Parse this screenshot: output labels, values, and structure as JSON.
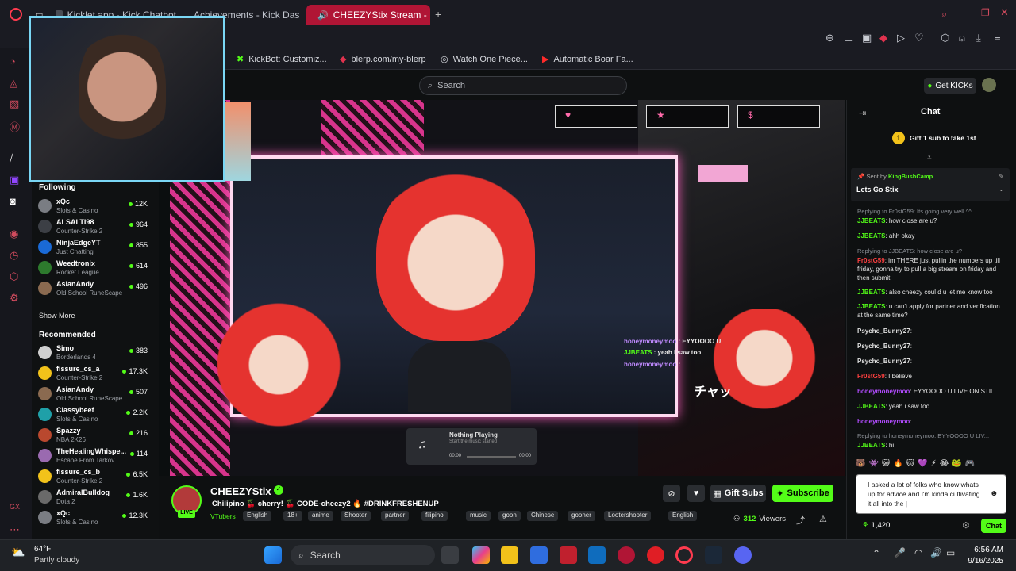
{
  "browser": {
    "tabs": [
      {
        "label": "Kicklet.app - Kick Chatbot"
      },
      {
        "label": "Achievements - Kick Das"
      },
      {
        "label": "CHEEZYStix Stream -"
      }
    ],
    "new_tab": "+",
    "bookmarks": [
      {
        "label": "KickBot: Customiz..."
      },
      {
        "label": "blerp.com/my-blerp"
      },
      {
        "label": "Watch One Piece..."
      },
      {
        "label": "Automatic Boar Fa..."
      }
    ]
  },
  "header": {
    "search_placeholder": "Search",
    "get_kicks": "Get KICKs"
  },
  "sidebar": {
    "following_title": "Following",
    "following": [
      {
        "name": "xQc",
        "category": "Slots & Casino",
        "viewers": "12K",
        "color": "#7a7d83"
      },
      {
        "name": "ALSALTI98",
        "category": "Counter-Strike 2",
        "viewers": "964",
        "color": "#3c3f45"
      },
      {
        "name": "NinjaEdgeYT",
        "category": "Just Chatting",
        "viewers": "855",
        "color": "#1a6ad6"
      },
      {
        "name": "Weedtronix",
        "category": "Rocket League",
        "viewers": "614",
        "color": "#2d7a2d"
      },
      {
        "name": "AsianAndy",
        "category": "Old School RuneScape",
        "viewers": "496",
        "color": "#8a6a50"
      }
    ],
    "show_more": "Show More",
    "recommended_title": "Recommended",
    "recommended": [
      {
        "name": "Simo",
        "category": "Borderlands 4",
        "viewers": "383",
        "color": "#cfcfcf"
      },
      {
        "name": "fissure_cs_a",
        "category": "Counter-Strike 2",
        "viewers": "17.3K",
        "color": "#f2c21a"
      },
      {
        "name": "AsianAndy",
        "category": "Old School RuneScape",
        "viewers": "507",
        "color": "#8a6a50"
      },
      {
        "name": "Classybeef",
        "category": "Slots & Casino",
        "viewers": "2.2K",
        "color": "#1fa0a8"
      },
      {
        "name": "Spazzy",
        "category": "NBA 2K26",
        "viewers": "216",
        "color": "#b9482e"
      },
      {
        "name": "TheHealingWhispe...",
        "category": "Escape From Tarkov",
        "viewers": "114",
        "color": "#9a6ab0"
      },
      {
        "name": "fissure_cs_b",
        "category": "Counter-Strike 2",
        "viewers": "6.5K",
        "color": "#f2c21a"
      },
      {
        "name": "AdmiralBulldog",
        "category": "Dota 2",
        "viewers": "1.6K",
        "color": "#6a6a6a"
      },
      {
        "name": "xQc",
        "category": "Slots & Casino",
        "viewers": "12.3K",
        "color": "#7a7d83"
      }
    ]
  },
  "player": {
    "top_icons": [
      "♥",
      "★",
      "$"
    ],
    "overlay_chat": [
      {
        "user": "honeymoneymoo",
        "text": " : EYYOOOO U"
      },
      {
        "user": "JJBEATS",
        "text": " : yeah i saw too"
      },
      {
        "user": "honeymoneymoo",
        "text": " : "
      }
    ],
    "jp_text": "チャッ",
    "now_playing_title": "Nothing Playing",
    "now_playing_sub": "Start the music started",
    "time_start": "00:00",
    "time_end": "00:00"
  },
  "stream": {
    "name": "CHEEZYStix",
    "live": "LIVE",
    "title": "Chilipino 🍒 cherry! 🍒 CODE-cheezy2 🔥 #DRINKFRESHENUP",
    "category": "VTubers",
    "tags": [
      "English",
      "18+",
      "anime",
      "Shooter",
      "partner",
      "filipino",
      "music",
      "goon",
      "Chinese",
      "gooner",
      "Lootershooter",
      "English"
    ],
    "viewers": "312",
    "viewers_label": "Viewers",
    "gift_subs": "Gift Subs",
    "subscribe": "Subscribe"
  },
  "chat": {
    "title": "Chat",
    "gift_banner": "Gift 1 sub to take 1st",
    "pinned_by_prefix": "Sent by",
    "pinned_by": "KingBushCamp",
    "pinned_text": "Lets Go Stix",
    "messages": [
      {
        "reply": "Replying to Fr0stG59: Its going very well ^^",
        "user": "JJBEATS",
        "text": "how close are u?",
        "ucolor": "#53fc18"
      },
      {
        "reply": "",
        "user": "JJBEATS",
        "text": "ahh okay",
        "ucolor": "#53fc18"
      },
      {
        "reply": "Replying to JJBEATS: how close are u?",
        "user": "Fr0stG59",
        "text": "im THERE just pullin the numbers up till friday, gonna try to pull a big stream on friday and then submit",
        "ucolor": "#ff4040"
      },
      {
        "reply": "",
        "user": "JJBEATS",
        "text": "also cheezy coul d u let me know too",
        "ucolor": "#53fc18"
      },
      {
        "reply": "",
        "user": "JJBEATS",
        "text": "u can't apply for partner and verification at the same time?",
        "ucolor": "#53fc18"
      },
      {
        "reply": "",
        "user": "Psycho_Bunny27",
        "text": "",
        "ucolor": "#e0e0e0"
      },
      {
        "reply": "",
        "user": "Psycho_Bunny27",
        "text": "",
        "ucolor": "#e0e0e0"
      },
      {
        "reply": "",
        "user": "Psycho_Bunny27",
        "text": "",
        "ucolor": "#e0e0e0"
      },
      {
        "reply": "",
        "user": "Fr0stG59",
        "text": "I believe",
        "ucolor": "#ff4040"
      },
      {
        "reply": "",
        "user": "honeymoneymoo",
        "text": "EYYOOOO U LIVE ON STILL",
        "ucolor": "#b24cff"
      },
      {
        "reply": "",
        "user": "JJBEATS",
        "text": "yeah i saw too",
        "ucolor": "#53fc18"
      },
      {
        "reply": "",
        "user": "honeymoneymoo",
        "text": "",
        "ucolor": "#b24cff"
      },
      {
        "reply": "Replying to honeymoneymoo: EYYOOOO U LIV...",
        "user": "JJBEATS",
        "text": "hi",
        "ucolor": "#53fc18"
      }
    ],
    "input_value": "I asked a lot of folks who know whats up for advice and I'm kinda cultivating it all into the |",
    "points": "1,420",
    "send": "Chat"
  },
  "taskbar": {
    "weather_temp": "64°F",
    "weather_desc": "Partly cloudy",
    "search": "Search",
    "time": "6:56 AM",
    "date": "9/16/2025"
  },
  "colors": {
    "kick_green": "#53fc18",
    "accent_red": "#b01535",
    "bg": "#0b0e0f"
  }
}
